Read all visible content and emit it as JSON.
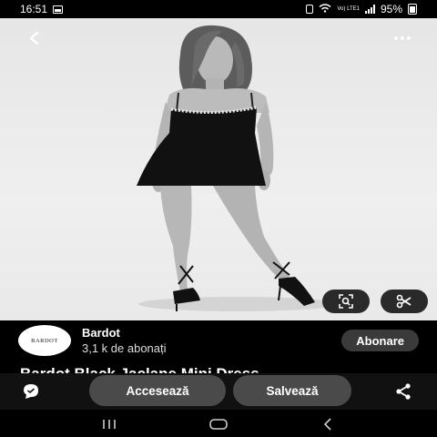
{
  "status_bar": {
    "time": "16:51",
    "network_label": "Vo) LTE1",
    "battery": "95%"
  },
  "image": {
    "description_icon": "model-photo"
  },
  "profile": {
    "avatar_text": "BARDOT",
    "name": "Bardot",
    "subscribers": "3,1 k de abonați",
    "follow_label": "Abonare"
  },
  "pin": {
    "title": "Bardot Black Jaclane Mini Dress"
  },
  "actions": {
    "visit_label": "Accesează",
    "save_label": "Salvează"
  },
  "icons": {
    "back": "back-arrow-icon",
    "more": "more-dots-icon",
    "lens": "visual-search-icon",
    "scissors": "scissors-icon",
    "comment": "comment-icon",
    "share": "share-icon",
    "recents": "recents-icon",
    "home": "home-icon",
    "nav_back": "nav-back-icon"
  },
  "colors": {
    "background": "#000000",
    "button_bg": "#4a4a4a",
    "chip_bg": "#2a2a2a"
  }
}
